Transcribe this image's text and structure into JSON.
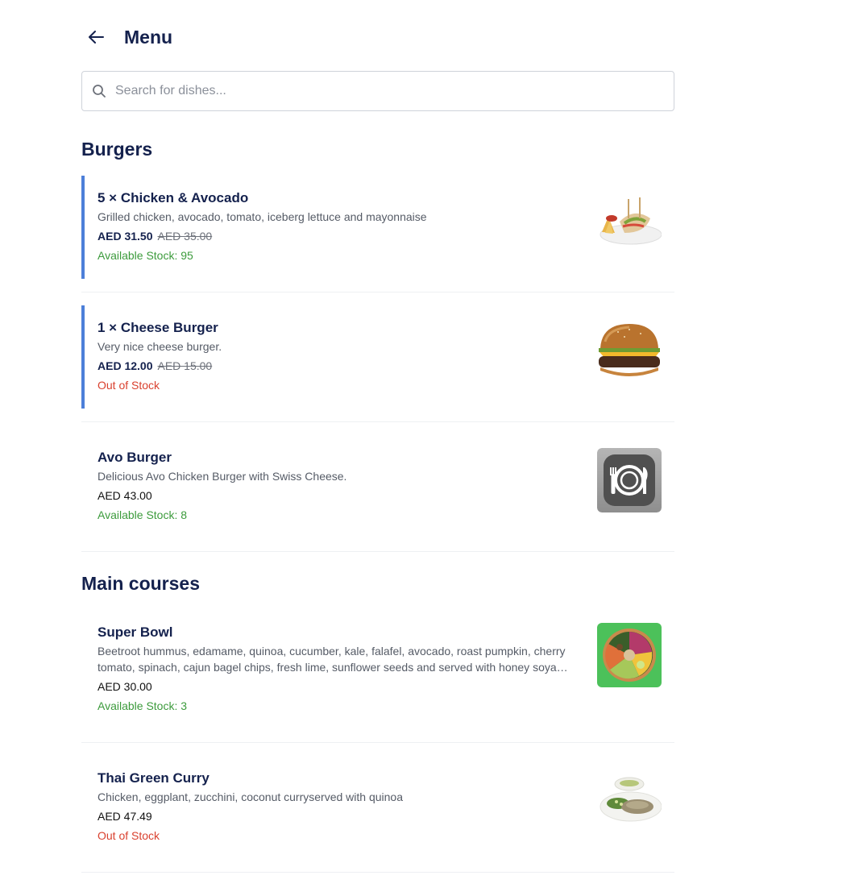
{
  "header": {
    "title": "Menu",
    "back_icon": "arrow-left-icon"
  },
  "search": {
    "placeholder": "Search for dishes...",
    "value": "",
    "icon": "search-icon"
  },
  "sections": [
    {
      "title": "Burgers",
      "items": [
        {
          "name": "5 × Chicken & Avocado",
          "description": "Grilled chicken, avocado, tomato, iceberg lettuce and mayonnaise",
          "price": "AED 31.50",
          "old_price": "AED 35.00",
          "stock": "Available Stock: 95",
          "in_cart": true,
          "image": "chicken-avocado-plate-photo"
        },
        {
          "name": "1 × Cheese Burger",
          "description": "Very nice cheese burger.",
          "price": "AED 12.00",
          "old_price": "AED 15.00",
          "stock": "Out of Stock",
          "in_cart": true,
          "image": "cheese-burger-photo"
        },
        {
          "name": "Avo Burger",
          "description": "Delicious Avo Chicken Burger with Swiss Cheese.",
          "price": "AED 43.00",
          "stock": "Available Stock: 8",
          "in_cart": false,
          "image": "plate-cutlery-placeholder-icon"
        }
      ]
    },
    {
      "title": "Main courses",
      "items": [
        {
          "name": "Super Bowl",
          "description": "Beetroot hummus, edamame, quinoa, cucumber, kale, falafel, avocado, roast pumpkin, cherry tomato, spinach, cajun bagel chips, fresh lime, sunflower seeds and served with honey soya dressing",
          "price": "AED 30.00",
          "stock": "Available Stock: 3",
          "in_cart": false,
          "image": "salad-bowl-photo"
        },
        {
          "name": "Thai Green Curry",
          "description": "Chicken, eggplant, zucchini, coconut curryserved with quinoa",
          "price": "AED 47.49",
          "stock": "Out of Stock",
          "in_cart": false,
          "image": "green-curry-photo"
        }
      ]
    }
  ],
  "colors": {
    "accent_bar": "#4d7fd9",
    "title": "#14214d",
    "in_stock": "#3c9b3c",
    "out_of_stock": "#d9412f"
  }
}
